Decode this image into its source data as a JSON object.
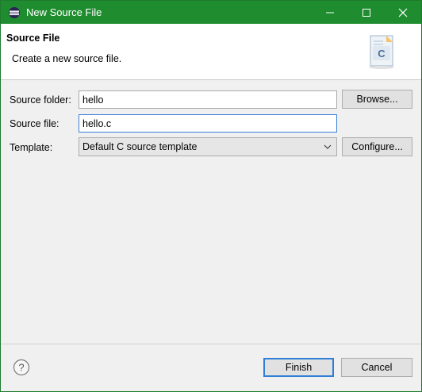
{
  "window": {
    "title": "New Source File",
    "controls": {
      "minimize": "—",
      "maximize": "☐",
      "close": "✕"
    }
  },
  "header": {
    "title": "Source File",
    "description": "Create a new source file.",
    "icon_letter": "C"
  },
  "form": {
    "source_folder": {
      "label": "Source folder:",
      "value": "hello",
      "button": "Browse..."
    },
    "source_file": {
      "label": "Source file:",
      "value": "hello.c"
    },
    "template": {
      "label": "Template:",
      "selected": "Default C source template",
      "button": "Configure..."
    }
  },
  "footer": {
    "finish": "Finish",
    "cancel": "Cancel"
  },
  "colors": {
    "titlebar": "#1f8d2f",
    "focus_border": "#3d7fd6",
    "default_button_border": "#2f7fd6"
  },
  "icons": [
    "eclipse-app-icon",
    "c-file-icon",
    "chevron-down-icon",
    "help-icon"
  ]
}
